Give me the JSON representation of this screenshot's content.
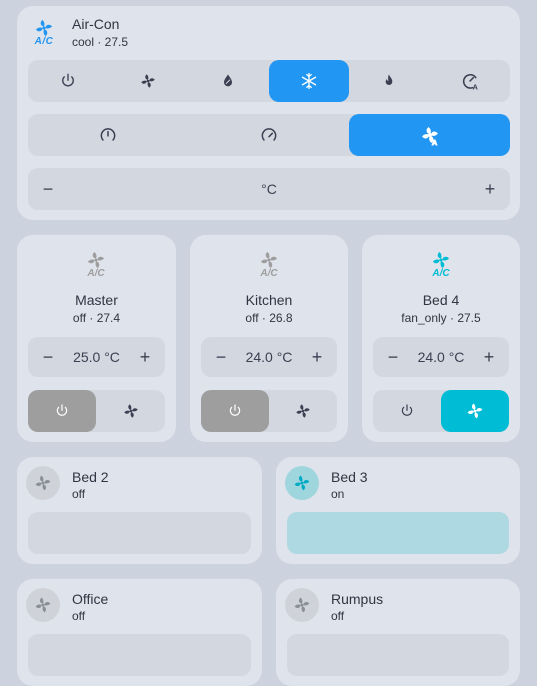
{
  "aircon": {
    "name": "Air-Con",
    "state": "cool · 27.5",
    "modes": [
      {
        "icon": "power-icon",
        "active": false
      },
      {
        "icon": "fan-icon",
        "active": false
      },
      {
        "icon": "dry-icon",
        "active": false
      },
      {
        "icon": "snowflake-icon",
        "active": true
      },
      {
        "icon": "flame-icon",
        "active": false
      },
      {
        "icon": "auto-mode-icon",
        "active": false
      }
    ],
    "fan_speeds": [
      {
        "icon": "fan-low-icon",
        "active": false
      },
      {
        "icon": "fan-medium-icon",
        "active": false
      },
      {
        "icon": "fan-auto-icon",
        "active": true
      }
    ],
    "temp_label": "°C",
    "minus": "−",
    "plus": "+"
  },
  "zones": [
    {
      "name": "Master",
      "state": "off · 27.4",
      "temp": "25.0 °C",
      "active": "power"
    },
    {
      "name": "Kitchen",
      "state": "off · 26.8",
      "temp": "24.0 °C",
      "active": "power"
    },
    {
      "name": "Bed 4",
      "state": "fan_only · 27.5",
      "temp": "24.0 °C",
      "active": "fan"
    }
  ],
  "fans": [
    {
      "name": "Bed 2",
      "state": "off"
    },
    {
      "name": "Bed 3",
      "state": "on"
    },
    {
      "name": "Office",
      "state": "off"
    },
    {
      "name": "Rumpus",
      "state": "off"
    }
  ],
  "colors": {
    "accent": "#2196f3",
    "fan_only": "#00bcd4",
    "off_active": "#9e9e9e",
    "fan_on_bar": "#afd9e2"
  }
}
